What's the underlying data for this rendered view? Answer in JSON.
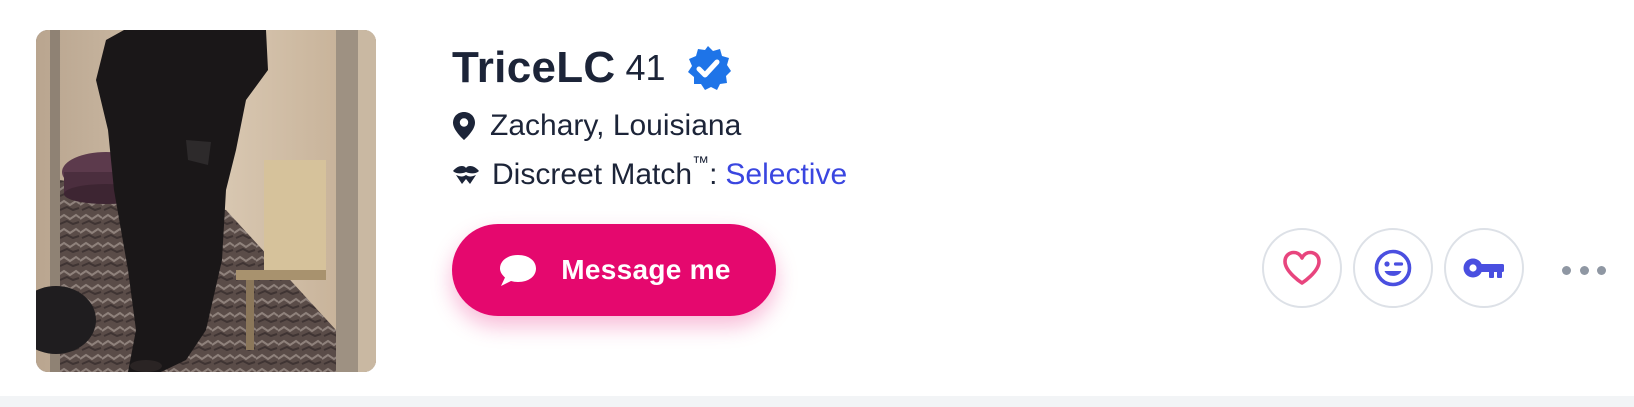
{
  "profile": {
    "username": "TriceLC",
    "age": "41",
    "verified_icon": "verified-badge-icon",
    "location": "Zachary, Louisiana",
    "discreet_match": {
      "label": "Discreet Match",
      "trademark": "™",
      "colon": ":",
      "value": "Selective"
    }
  },
  "actions": {
    "message_label": "Message me",
    "icons": [
      "chat-bubble-icon",
      "heart-icon",
      "wink-icon",
      "key-icon",
      "more-dots-icon"
    ]
  },
  "colors": {
    "primary_text": "#1c2438",
    "accent_pink": "#e5086e",
    "link_blue": "#3a46e0",
    "verified_blue": "#1e74e8",
    "heart_pink": "#e8457e",
    "icon_indigo": "#4a4fe0",
    "circle_border": "#dde1e7",
    "dots_gray": "#8f97a3"
  }
}
